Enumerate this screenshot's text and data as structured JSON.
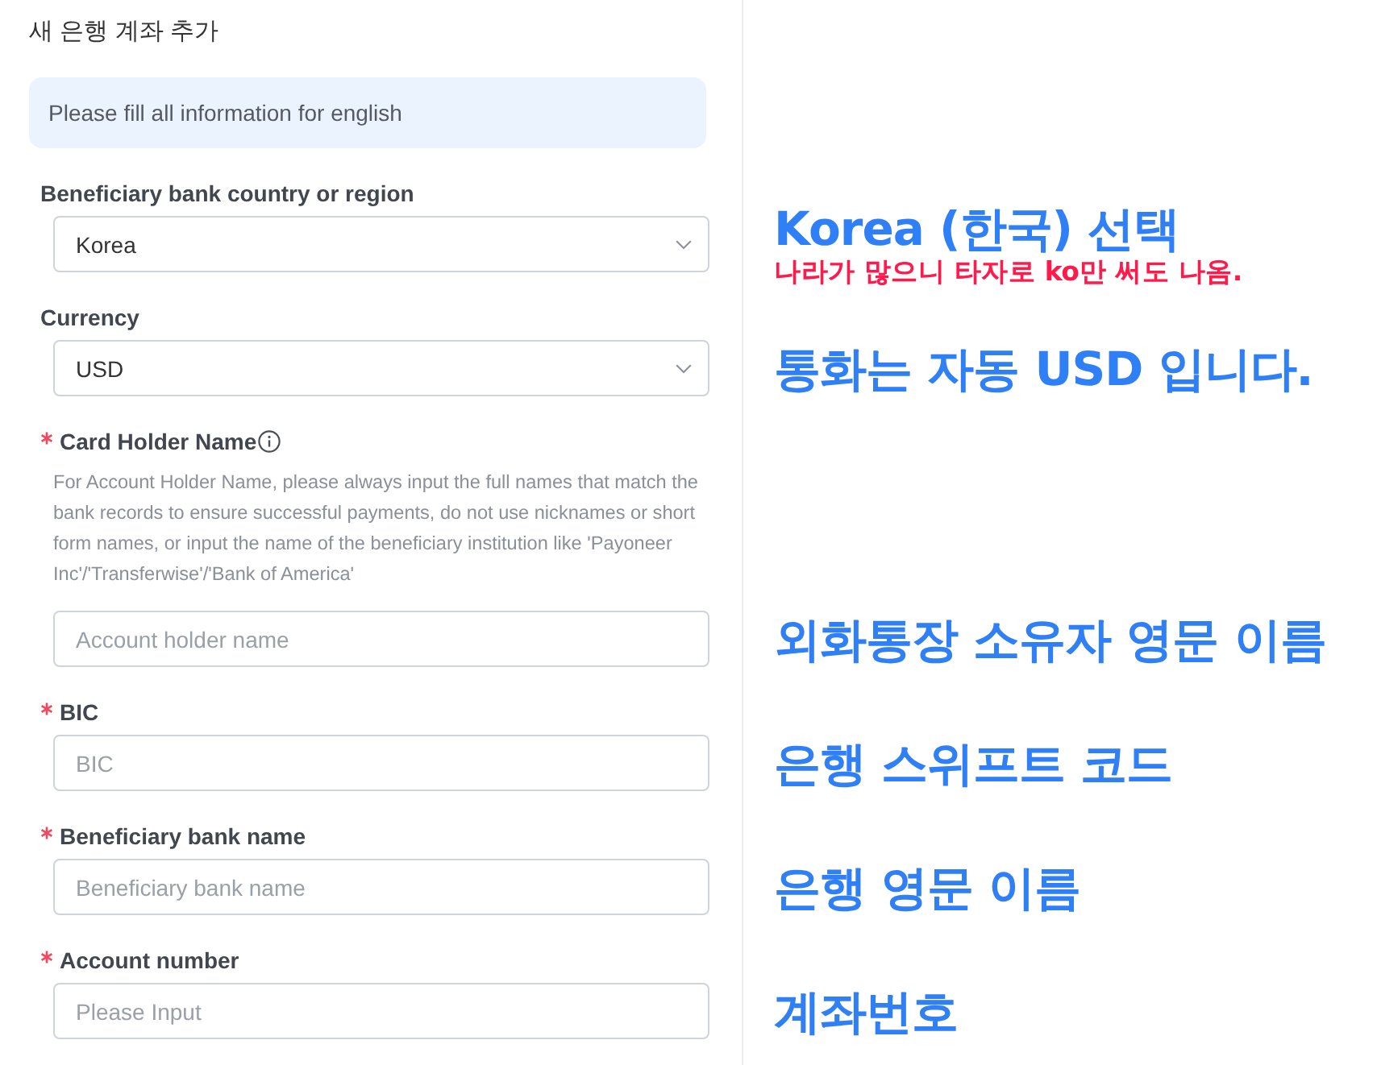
{
  "title": "새 은행 계좌 추가",
  "notice": "Please fill all information for english",
  "fields": [
    {
      "kind": "select",
      "required": false,
      "info": false,
      "label": "Beneficiary bank country or region",
      "value": "Korea",
      "annotation": {
        "text": "Korea (한국) 선택",
        "note": "나라가 많으니 타자로 ko만 써도 나옴."
      }
    },
    {
      "kind": "select",
      "required": false,
      "info": false,
      "label": "Currency",
      "value": "USD",
      "annotation": {
        "text": "통화는 자동 USD 입니다."
      }
    },
    {
      "kind": "input",
      "required": true,
      "info": true,
      "label": "Card Holder Name",
      "help": "For Account Holder Name, please always input the full names that match the bank records to ensure successful payments, do not use nicknames or short form names, or input the name of the beneficiary institution like 'Payoneer Inc'/'Transferwise'/'Bank of America'",
      "placeholder": "Account holder name",
      "annotation": {
        "text": "외화통장 소유자 영문 이름"
      }
    },
    {
      "kind": "input",
      "required": true,
      "info": false,
      "label": "BIC",
      "placeholder": "BIC",
      "annotation": {
        "text": "은행 스위프트 코드"
      }
    },
    {
      "kind": "input",
      "required": true,
      "info": false,
      "label": "Beneficiary bank name",
      "placeholder": "Beneficiary bank name",
      "annotation": {
        "text": "은행 영문 이름"
      }
    },
    {
      "kind": "input",
      "required": true,
      "info": false,
      "label": "Account number",
      "placeholder": "Please Input",
      "annotation": {
        "text": "계좌번호"
      }
    }
  ]
}
